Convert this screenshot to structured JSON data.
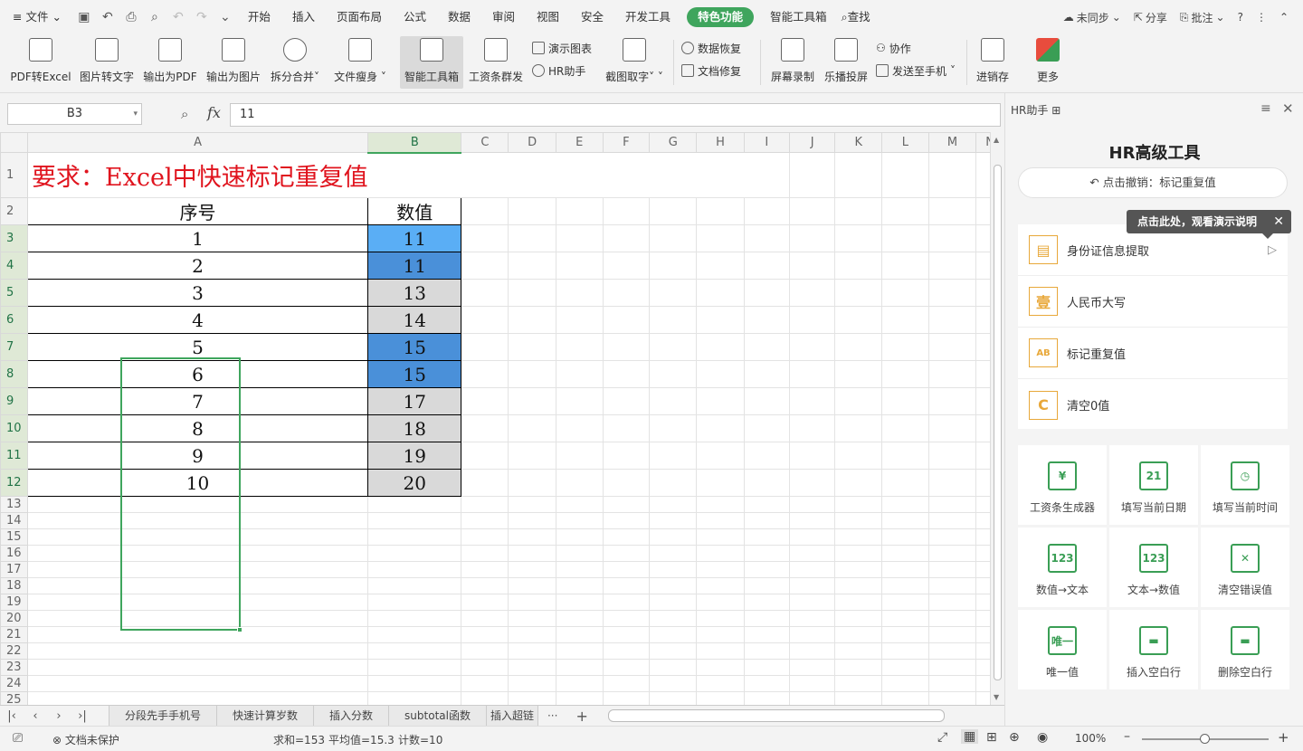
{
  "menubar": {
    "file": "文件",
    "tabs": [
      "开始",
      "插入",
      "页面布局",
      "公式",
      "数据",
      "审阅",
      "视图",
      "安全",
      "开发工具",
      "特色功能",
      "智能工具箱"
    ],
    "search": "查找",
    "sync": "未同步",
    "share": "分享",
    "comment": "批注"
  },
  "ribbon": {
    "pdf_to_excel": "PDF转Excel",
    "image_to_text": "图片转文字",
    "export_pdf": "输出为PDF",
    "export_image": "输出为图片",
    "split_merge": "拆分合并",
    "file_slim": "文件瘦身",
    "smart_toolbox": "智能工具箱",
    "salary_send": "工资条群发",
    "demo_chart": "演示图表",
    "hr_assistant": "HR助手",
    "screenshot_text": "截图取字",
    "data_recovery": "数据恢复",
    "doc_repair": "文档修复",
    "screen_record": "屏幕录制",
    "cast": "乐播投屏",
    "collab": "协作",
    "send_phone": "发送至手机",
    "inventory": "进销存",
    "more": "更多"
  },
  "formula": {
    "cell_ref": "B3",
    "fx": "fx",
    "value": "11"
  },
  "sheet": {
    "columns": [
      "A",
      "B",
      "C",
      "D",
      "E",
      "F",
      "G",
      "H",
      "I",
      "J",
      "K",
      "L",
      "M",
      "N"
    ],
    "title": "要求：Excel中快速标记重复值",
    "header_a": "序号",
    "header_b": "数值",
    "rows": [
      [
        "1",
        "11"
      ],
      [
        "2",
        "11"
      ],
      [
        "3",
        "13"
      ],
      [
        "4",
        "14"
      ],
      [
        "5",
        "15"
      ],
      [
        "6",
        "15"
      ],
      [
        "7",
        "17"
      ],
      [
        "8",
        "18"
      ],
      [
        "9",
        "19"
      ],
      [
        "10",
        "20"
      ]
    ],
    "row_numbers": [
      "1",
      "2",
      "3",
      "4",
      "5",
      "6",
      "7",
      "8",
      "9",
      "10",
      "11",
      "12",
      "13",
      "14",
      "15",
      "16",
      "17",
      "18",
      "19",
      "20",
      "21",
      "22",
      "23",
      "24",
      "25"
    ]
  },
  "tabs": {
    "sheets": [
      "分段先手手机号",
      "快速计算岁数",
      "插入分数",
      "subtotal函数",
      "插入超链"
    ]
  },
  "status": {
    "protect": "文档未保护",
    "sum": "求和=153",
    "avg": "平均值=15.3",
    "count": "计数=10",
    "zoom": "100%"
  },
  "panel": {
    "title": "HR助手",
    "heading": "HR高级工具",
    "undo": "点击撤销：标记重复值",
    "tooltip": "点击此处，观看演示说明",
    "tools": [
      "身份证信息提取",
      "人民币大写",
      "标记重复值",
      "清空0值"
    ],
    "grid": [
      "工资条生成器",
      "填写当前日期",
      "填写当前时间",
      "数值→文本",
      "文本→数值",
      "清空错误值",
      "唯一值",
      "插入空白行",
      "删除空白行"
    ],
    "grid_icons": [
      "¥",
      "21",
      "◷",
      "123",
      "123",
      "✕",
      "唯一",
      "▬",
      "▬"
    ]
  },
  "colors": {
    "accent": "#3fa55d",
    "highlight": "#4a90d9",
    "title_red": "#e0141e"
  }
}
